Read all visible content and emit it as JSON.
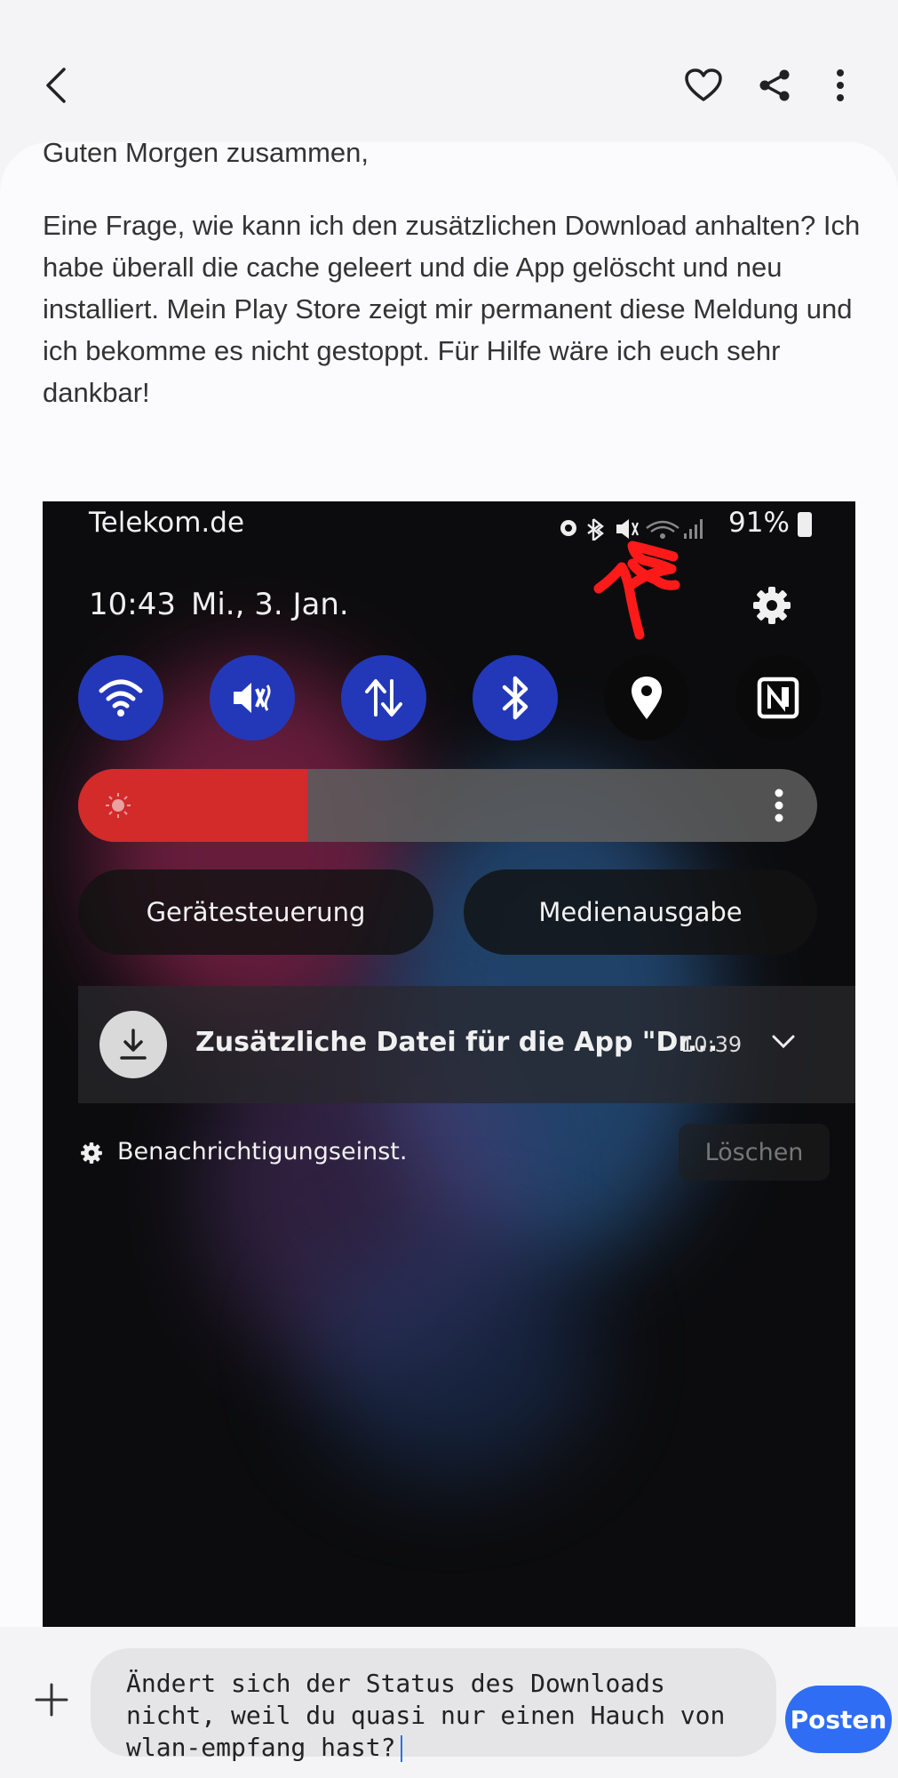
{
  "header": {
    "back_icon": "chevron-left-icon",
    "like_icon": "heart-icon",
    "share_icon": "share-icon",
    "more_icon": "more-vertical-icon"
  },
  "post": {
    "greeting": "Guten Morgen zusammen,",
    "body": "Eine Frage, wie kann ich den zusätzlichen Download anhalten? Ich habe überall die cache geleert und die App gelöscht und neu installiert. Mein Play Store zeigt mir permanent diese Meldung und ich bekomme es nicht gestoppt. Für Hilfe wäre ich euch sehr dankbar!"
  },
  "screenshot": {
    "carrier": "Telekom.de",
    "battery": "91%",
    "time": "10:43",
    "date": "Mi., 3. Jan.",
    "quick_toggles": [
      "wifi-icon",
      "mute-icon",
      "data-icon",
      "bluetooth-icon",
      "location-icon",
      "nfc-icon"
    ],
    "brightness_level": 0.31,
    "device_control": "Gerätesteuerung",
    "media_output": "Medienausgabe",
    "notification": {
      "title": "Zusätzliche Datei für die App \"Dr...",
      "time": "10:39"
    },
    "notification_settings": "Benachrichtigungseinst.",
    "clear": "Löschen",
    "annotation_color": "#ff1a1a"
  },
  "composer": {
    "text": "Ändert sich der Status des Downloads nicht, weil du quasi nur einen Hauch von wlan-empfang hast?",
    "post_label": "Posten"
  },
  "colors": {
    "accent": "#2f6df5",
    "toggle_on": "#2338b8",
    "brightness_fill": "#d32a2a"
  }
}
